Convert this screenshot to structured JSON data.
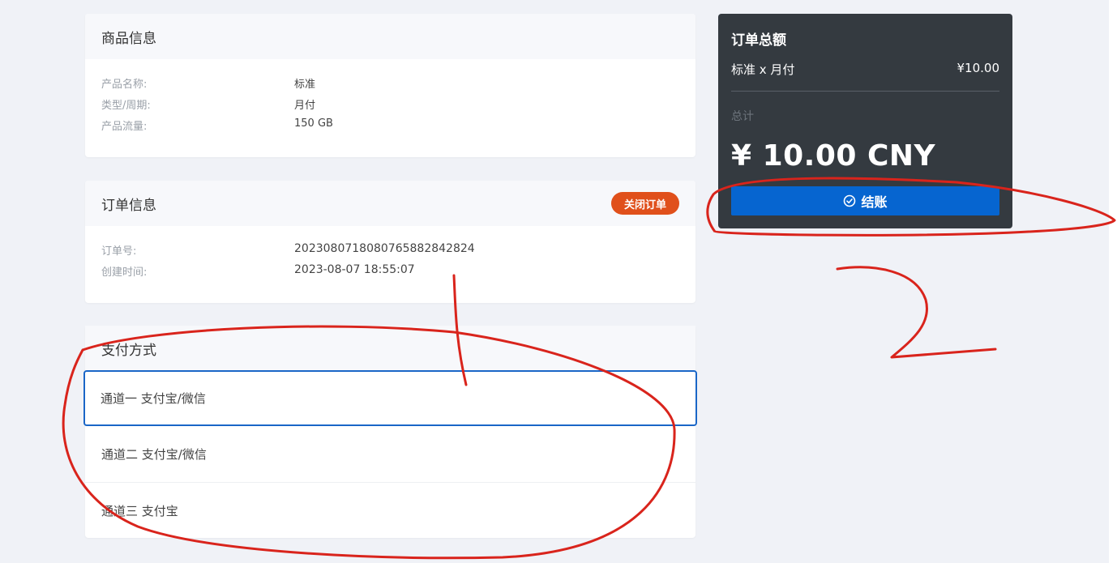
{
  "product": {
    "title": "商品信息",
    "rows": [
      {
        "label": "产品名称:",
        "value": "标准"
      },
      {
        "label": "类型/周期:",
        "value": "月付"
      },
      {
        "label": "产品流量:",
        "value": "150 GB"
      }
    ]
  },
  "order": {
    "title": "订单信息",
    "close_label": "关闭订单",
    "rows": [
      {
        "label": "订单号:",
        "value": "2023080718080765882842824"
      },
      {
        "label": "创建时间:",
        "value": "2023-08-07 18:55:07"
      }
    ]
  },
  "payment": {
    "title": "支付方式",
    "methods": [
      {
        "label": "通道一 支付宝/微信",
        "selected": true
      },
      {
        "label": "通道二 支付宝/微信",
        "selected": false
      },
      {
        "label": "通道三 支付宝",
        "selected": false
      }
    ]
  },
  "summary": {
    "title": "订单总额",
    "item_label": "标准 x 月付",
    "item_price": "¥10.00",
    "total_label": "总计",
    "total_amount": "¥ 10.00 CNY",
    "checkout_label": "结账",
    "checkout_icon": "check-circle-icon"
  },
  "annotation": {
    "number": "2",
    "color": "#d9241c"
  },
  "colors": {
    "accent": "#0665d0",
    "danger": "#e0501b",
    "summary_bg": "#343a40"
  }
}
